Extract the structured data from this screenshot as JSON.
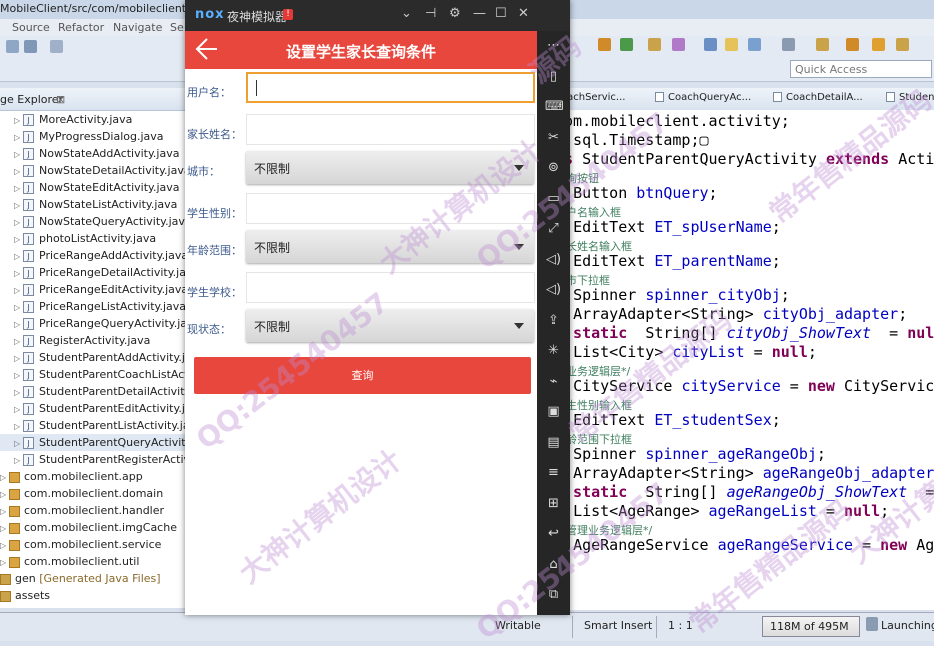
{
  "ide": {
    "title": "MobileClient/src/com/mobileclient/ac",
    "menu": [
      "Source",
      "Refactor",
      "Navigate",
      "Se"
    ],
    "quick_access": "Quick Access",
    "explorer_title": "ge Explorer",
    "explorer_close": "⊠",
    "files": [
      "MoreActivity.java",
      "MyProgressDialog.java",
      "NowStateAddActivity.java",
      "NowStateDetailActivity.java",
      "NowStateEditActivity.java",
      "NowStateListActivity.java",
      "NowStateQueryActivity.java",
      "photoListActivity.java",
      "PriceRangeAddActivity.java",
      "PriceRangeDetailActivity.java",
      "PriceRangeEditActivity.java",
      "PriceRangeListActivity.java",
      "PriceRangeQueryActivity.java",
      "RegisterActivity.java",
      "StudentParentAddActivity.jav",
      "StudentParentCoachListActivi",
      "StudentParentDetailActivity.ja",
      "StudentParentEditActivity.jav",
      "StudentParentListActivity.java",
      "StudentParentQueryActivity.ja",
      "StudentParentRegisterActivity"
    ],
    "packages": [
      "com.mobileclient.app",
      "com.mobileclient.domain",
      "com.mobileclient.handler",
      "com.mobileclient.imgCache",
      "com.mobileclient.service",
      "com.mobileclient.util"
    ],
    "gen_label": "gen",
    "gen_note": "[Generated Java Files]",
    "assets_label": "assets",
    "editor_tabs": [
      "oachServic...",
      "CoachQueryAc...",
      "CoachDetailA...",
      "Studen"
    ],
    "code_lines": [
      {
        "t": "code",
        "parts": [
          [
            "",
            "com.mobileclient.activity;"
          ]
        ]
      },
      {
        "t": "code",
        "parts": [
          [
            "",
            "a.sql.Timestamp;"
          ],
          [
            "",
            "▢"
          ]
        ]
      },
      {
        "t": "code",
        "parts": [
          [
            "kw",
            "ss "
          ],
          [
            "",
            "StudentParentQueryActivity "
          ],
          [
            "kw",
            "extends "
          ],
          [
            "",
            "Activ"
          ]
        ]
      },
      {
        "t": "cmt",
        "text": "查询按钮"
      },
      {
        "t": "code",
        "parts": [
          [
            "kw",
            "e "
          ],
          [
            "",
            "Button "
          ],
          [
            "fld",
            "btnQuery"
          ],
          [
            "",
            ";"
          ]
        ]
      },
      {
        "t": "cmt",
        "text": "用户名输入框"
      },
      {
        "t": "code",
        "parts": [
          [
            "kw",
            "e "
          ],
          [
            "",
            "EditText "
          ],
          [
            "fld",
            "ET_spUserName"
          ],
          [
            "",
            ";"
          ]
        ]
      },
      {
        "t": "cmt",
        "text": "家长姓名输入框"
      },
      {
        "t": "code",
        "parts": [
          [
            "kw",
            "e "
          ],
          [
            "",
            "EditText "
          ],
          [
            "fld",
            "ET_parentName"
          ],
          [
            "",
            ";"
          ]
        ]
      },
      {
        "t": "cmt",
        "text": "城市下拉框"
      },
      {
        "t": "code",
        "parts": [
          [
            "kw",
            "e "
          ],
          [
            "",
            "Spinner "
          ],
          [
            "fld",
            "spinner_cityObj"
          ],
          [
            "",
            ";"
          ]
        ]
      },
      {
        "t": "code",
        "parts": [
          [
            "kw",
            "e "
          ],
          [
            "",
            "ArrayAdapter<String> "
          ],
          [
            "fld",
            "cityObj_adapter"
          ],
          [
            "",
            ";"
          ]
        ]
      },
      {
        "t": "code",
        "parts": [
          [
            "kw",
            "e static  "
          ],
          [
            "",
            "String[] "
          ],
          [
            "fld ital",
            "cityObj_ShowText"
          ],
          [
            "",
            "  = "
          ],
          [
            "kw",
            "null"
          ]
        ]
      },
      {
        "t": "code",
        "parts": [
          [
            "kw",
            "e "
          ],
          [
            "",
            "List<City> "
          ],
          [
            "fld",
            "cityList"
          ],
          [
            "",
            " = "
          ],
          [
            "kw",
            "null"
          ],
          [
            "",
            ";"
          ]
        ]
      },
      {
        "t": "cmt",
        "text": "理业务逻辑层*/"
      },
      {
        "t": "code",
        "parts": [
          [
            "kw",
            "e "
          ],
          [
            "",
            "CityService "
          ],
          [
            "fld",
            "cityService"
          ],
          [
            "",
            " = "
          ],
          [
            "kw",
            "new "
          ],
          [
            "",
            "CityService"
          ]
        ]
      },
      {
        "t": "cmt",
        "text": "学生性别输入框"
      },
      {
        "t": "code",
        "parts": [
          [
            "kw",
            "e "
          ],
          [
            "",
            "EditText "
          ],
          [
            "fld",
            "ET_studentSex"
          ],
          [
            "",
            ";"
          ]
        ]
      },
      {
        "t": "cmt",
        "text": "年龄范围下拉框"
      },
      {
        "t": "code",
        "parts": [
          [
            "kw",
            "e "
          ],
          [
            "",
            "Spinner "
          ],
          [
            "fld",
            "spinner_ageRangeObj"
          ],
          [
            "",
            ";"
          ]
        ]
      },
      {
        "t": "code",
        "parts": [
          [
            "kw",
            "e "
          ],
          [
            "",
            "ArrayAdapter<String> "
          ],
          [
            "fld",
            "ageRangeObj_adapter"
          ],
          [
            "",
            ";"
          ]
        ]
      },
      {
        "t": "code",
        "parts": [
          [
            "kw",
            "e static  "
          ],
          [
            "",
            "String[] "
          ],
          [
            "fld ital",
            "ageRangeObj_ShowText"
          ],
          [
            "",
            "  ="
          ]
        ]
      },
      {
        "t": "code",
        "parts": [
          [
            "kw",
            "e "
          ],
          [
            "",
            "List<AgeRange> "
          ],
          [
            "fld",
            "ageRangeList"
          ],
          [
            "",
            " = "
          ],
          [
            "kw",
            "null"
          ],
          [
            "",
            ";"
          ]
        ]
      },
      {
        "t": "cmt",
        "text": "围管理业务逻辑层*/"
      },
      {
        "t": "code",
        "parts": [
          [
            "kw",
            "e "
          ],
          [
            "",
            "AgeRangeService "
          ],
          [
            "fld",
            "ageRangeService"
          ],
          [
            "",
            " = "
          ],
          [
            "kw",
            "new "
          ],
          [
            "",
            "Age"
          ]
        ]
      }
    ],
    "status": {
      "writable": "Writable",
      "insert_mode": "Smart Insert",
      "position": "1 : 1",
      "heap": "118M of 495M",
      "launching": "Launching"
    }
  },
  "nox": {
    "logo": "nox",
    "name": "夜神模拟器",
    "badge": "!",
    "controls": [
      "⌄",
      "⊣",
      "⚙",
      "—",
      "☐",
      "✕"
    ],
    "sidebar_icons": [
      "⋯",
      "▯",
      "⌨",
      "✂",
      "⊚",
      "▭",
      "⤢",
      "◁)",
      "◁)",
      "⇪",
      "✳",
      "⌁",
      "▣",
      "▤",
      "≡",
      "⊞",
      "↩",
      "⌂",
      "⧉"
    ]
  },
  "app": {
    "title": "设置学生家长查询条件",
    "back_icon": "back-arrow",
    "fields": [
      {
        "label": "用户名：",
        "type": "input",
        "value": "",
        "active": true
      },
      {
        "label": "家长姓名：",
        "type": "input",
        "value": ""
      },
      {
        "label": "城市：",
        "type": "select",
        "value": "不限制"
      },
      {
        "label": "学生性别：",
        "type": "input",
        "value": ""
      },
      {
        "label": "年龄范围：",
        "type": "select",
        "value": "不限制"
      },
      {
        "label": "学生学校：",
        "type": "input",
        "value": ""
      },
      {
        "label": "现状态：",
        "type": "select",
        "value": "不限制"
      }
    ],
    "query_button": "查询"
  },
  "watermarks": [
    "大神计算机设计",
    "QQ:254540457",
    "常年售精品源码",
    "大神计算机设计",
    "QQ:254540457",
    "常年售精品源码",
    "QQ:254540457",
    "常年售精品源码",
    "大神计算机设计",
    "源码"
  ],
  "colors": {
    "app_red": "#e8473e",
    "label_blue": "#3c5a8c",
    "focus_orange": "#f0a030"
  }
}
